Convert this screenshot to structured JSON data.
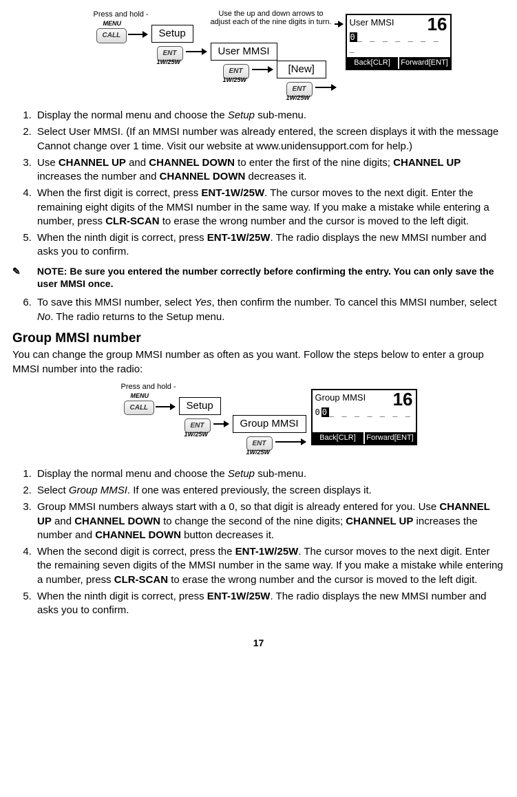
{
  "diagram1": {
    "press_hold": "Press and hold -",
    "menu": "MENU",
    "call": "CALL",
    "ent": "ENT",
    "sub": "1W/25W",
    "setup": "Setup",
    "user_mmsi": "User MMSI",
    "new": "[New]",
    "hint": "Use the up and down arrows to adjust each of the nine digits in turn.",
    "screen": {
      "title": "User MMSI",
      "ch": "16",
      "entry_cursor": "0",
      "entry_rest": "_ _ _ _ _ _ _ _",
      "back": "Back[CLR]",
      "forward": "Forward[ENT]"
    }
  },
  "list1": {
    "i1a": "Display the normal menu and choose the ",
    "i1b": "Setup",
    "i1c": " sub-menu.",
    "i2": "Select User MMSI. (If an MMSI number was already entered, the screen displays it with the message Cannot change over 1 time. Visit our website at www.unidensupport.com for help.)",
    "i3a": "Use ",
    "i3b": "CHANNEL UP",
    "i3c": " and ",
    "i3d": "CHANNEL DOWN",
    "i3e": " to enter the first of the nine digits; ",
    "i3f": "CHANNEL UP",
    "i3g": " increases the number and ",
    "i3h": "CHANNEL DOWN",
    "i3i": " decreases it.",
    "i4a": "When the first digit is correct, press ",
    "i4b": "ENT-1W/25W",
    "i4c": ". The cursor moves to the next digit. Enter the remaining eight digits of the MMSI number in the same way.  If you make a mistake while entering a number, press ",
    "i4d": "CLR-SCAN",
    "i4e": " to erase the wrong number and the cursor is moved to the left digit.",
    "i5a": "When the ninth digit is correct, press ",
    "i5b": "ENT-1W/25W",
    "i5c": ". The radio displays the new MMSI number and asks you to confirm."
  },
  "note": "NOTE: Be sure you entered the number correctly before confirming the entry. You can only save the user MMSI once.",
  "list1b": {
    "i6a": "To save this MMSI number, select ",
    "i6b": "Yes",
    "i6c": ", then confirm the number. To cancel this MMSI number, select ",
    "i6d": "No",
    "i6e": ". The radio returns to the Setup menu."
  },
  "h2": "Group MMSI number",
  "intro": "You can change the group MMSI number as often as you want. Follow the steps below to enter a group MMSI number into the radio:",
  "diagram2": {
    "press_hold": "Press and hold -",
    "menu": "MENU",
    "call": "CALL",
    "ent": "ENT",
    "sub": "1W/25W",
    "setup": "Setup",
    "group_mmsi": "Group MMSI",
    "screen": {
      "title": "Group MMSI",
      "ch": "16",
      "entry_pre": "0",
      "entry_cursor": "0",
      "entry_rest": "_ _ _ _ _ _ _",
      "back": "Back[CLR]",
      "forward": "Forward[ENT]"
    }
  },
  "list2": {
    "i1a": "Display the normal menu and choose the ",
    "i1b": "Setup",
    "i1c": " sub-menu.",
    "i2a": "Select ",
    "i2b": "Group MMSI",
    "i2c": ". If one was entered previously, the screen displays it.",
    "i3a": "Group MMSI numbers always start with a 0, so that digit is already entered for you. Use ",
    "i3b": "CHANNEL UP",
    "i3c": " and ",
    "i3d": "CHANNEL DOWN",
    "i3e": " to change the second of the nine digits; ",
    "i3f": "CHANNEL UP",
    "i3g": " increases the number and ",
    "i3h": "CHANNEL DOWN",
    "i3i": " button decreases it.",
    "i4a": "When the second digit is correct, press the ",
    "i4b": "ENT-1W/25W",
    "i4c": ". The cursor moves to the next digit. Enter the remaining seven digits of the MMSI number in the same way.  If you make a mistake while entering a number, press ",
    "i4d": "CLR-SCAN",
    "i4e": " to erase the wrong number and the cursor is moved to the left digit.",
    "i5a": "When the ninth digit is correct, press ",
    "i5b": "ENT-1W/25W",
    "i5c": ". The radio displays the new MMSI number and asks you to confirm."
  },
  "page": "17"
}
